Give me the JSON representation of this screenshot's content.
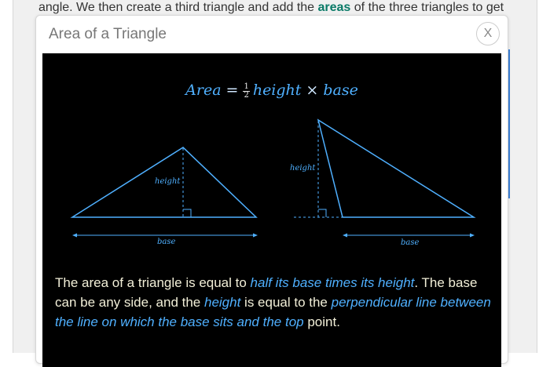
{
  "background": {
    "text_before": "angle. We then create a third triangle and add the ",
    "link_text": "areas",
    "text_after": " of the three triangles to get"
  },
  "dialog": {
    "title": "Area of a Triangle",
    "close_label": "X"
  },
  "formula": {
    "lhs": "Area",
    "equals": "=",
    "fraction_num": "1",
    "fraction_den": "2",
    "term1": "height",
    "times": "×",
    "term2": "base"
  },
  "diagram": {
    "left_height_label": "height",
    "left_base_label": "base",
    "right_height_label": "height",
    "right_base_label": "base"
  },
  "description": {
    "p1": "The area of a triangle is equal to ",
    "hl1": "half its base times its height",
    "p2": ". The base can be any side, and the ",
    "hl2": "height",
    "p3": " is equal to the ",
    "hl3": "perpendicular line between the line on which the base sits and the top",
    "p4": " point."
  },
  "colors": {
    "accent_link": "#0a7a67",
    "diagram_blue": "#4fb0ff",
    "description_text": "#f2efd8",
    "content_bg": "#000000"
  }
}
